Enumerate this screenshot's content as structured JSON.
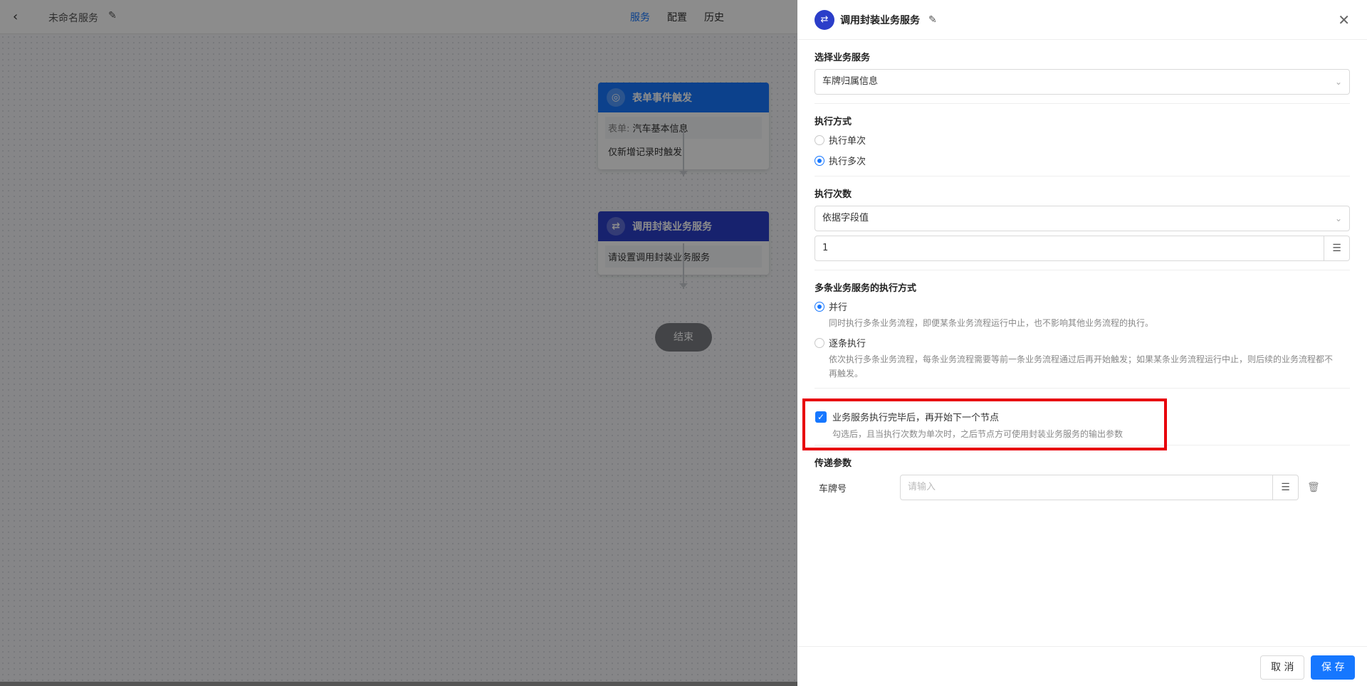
{
  "topbar": {
    "service_name": "未命名服务",
    "nav": [
      {
        "label": "服务",
        "active": true
      },
      {
        "label": "配置",
        "active": false
      },
      {
        "label": "历史",
        "active": false
      }
    ]
  },
  "canvas": {
    "node1": {
      "title": "表单事件触发",
      "form_label": "表单:",
      "form_value": "汽车基本信息",
      "trigger_text": "仅新增记录时触发"
    },
    "node2": {
      "title": "调用封装业务服务",
      "body_text": "请设置调用封装业务服务"
    },
    "end_label": "结束"
  },
  "drawer": {
    "title": "调用封装业务服务",
    "select_service": {
      "label": "选择业务服务",
      "value": "车牌归属信息"
    },
    "exec_mode": {
      "label": "执行方式",
      "options": [
        {
          "label": "执行单次",
          "selected": false
        },
        {
          "label": "执行多次",
          "selected": true
        }
      ]
    },
    "exec_count": {
      "label": "执行次数",
      "select_value": "依据字段值",
      "input_value": "1"
    },
    "multi_mode": {
      "label": "多条业务服务的执行方式",
      "options": [
        {
          "label": "并行",
          "selected": true,
          "desc": "同时执行多条业务流程，即便某条业务流程运行中止，也不影响其他业务流程的执行。"
        },
        {
          "label": "逐条执行",
          "selected": false,
          "desc": "依次执行多条业务流程，每条业务流程需要等前一条业务流程通过后再开始触发；如果某条业务流程运行中止，则后续的业务流程都不再触发。"
        }
      ]
    },
    "wait_option": {
      "checked": true,
      "label": "业务服务执行完毕后，再开始下一个节点",
      "desc": "勾选后，且当执行次数为单次时，之后节点方可使用封装业务服务的输出参数"
    },
    "params": {
      "label": "传递参数",
      "rows": [
        {
          "name": "车牌号",
          "placeholder": "请输入"
        }
      ]
    },
    "footer": {
      "cancel_label": "取 消",
      "save_label": "保 存"
    }
  },
  "colors": {
    "primary": "#1677ff",
    "node2_header": "#2b3ec9",
    "highlight_border": "#e8000b"
  }
}
